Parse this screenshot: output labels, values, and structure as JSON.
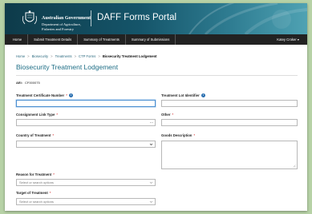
{
  "header": {
    "gov_title": "Australian Government",
    "gov_sub_1": "Department of Agriculture,",
    "gov_sub_2": "Fisheries and Forestry",
    "portal_title": "DAFF Forms Portal"
  },
  "nav": {
    "items": [
      {
        "label": "Home"
      },
      {
        "label": "Submit Treatment Details"
      },
      {
        "label": "Summary of Treatments"
      },
      {
        "label": "Summary of Submissions"
      }
    ],
    "user": "Katey Croker ▾"
  },
  "breadcrumb": [
    "Home",
    "Biosecurity",
    "Treatments",
    "CTP Forms",
    "Biosecurity Treatment Lodgement"
  ],
  "page_title": "Biosecurity Treatment Lodgement",
  "abe": {
    "label": "AEI:",
    "value": "CF000075"
  },
  "fields": {
    "cert_number": {
      "label": "Treatment Certificate Number",
      "value": ""
    },
    "lot_identifier": {
      "label": "Treatment Lot Identifier",
      "value": ""
    },
    "consignment_link": {
      "label": "Consignment Link Type",
      "value": "",
      "suffix": "..."
    },
    "other": {
      "label": "Other",
      "value": ""
    },
    "country": {
      "label": "Country of Treatment",
      "value": ""
    },
    "goods": {
      "label": "Goods Description"
    },
    "reason": {
      "label": "Reason for Treatment",
      "placeholder": "Select or search options"
    },
    "target": {
      "label": "Target of Treatment",
      "placeholder": "Select or search options"
    }
  },
  "required_marker": "*",
  "colors": {
    "accent": "#1f6e86",
    "nav": "#222222",
    "focus": "#4b8fd1"
  }
}
